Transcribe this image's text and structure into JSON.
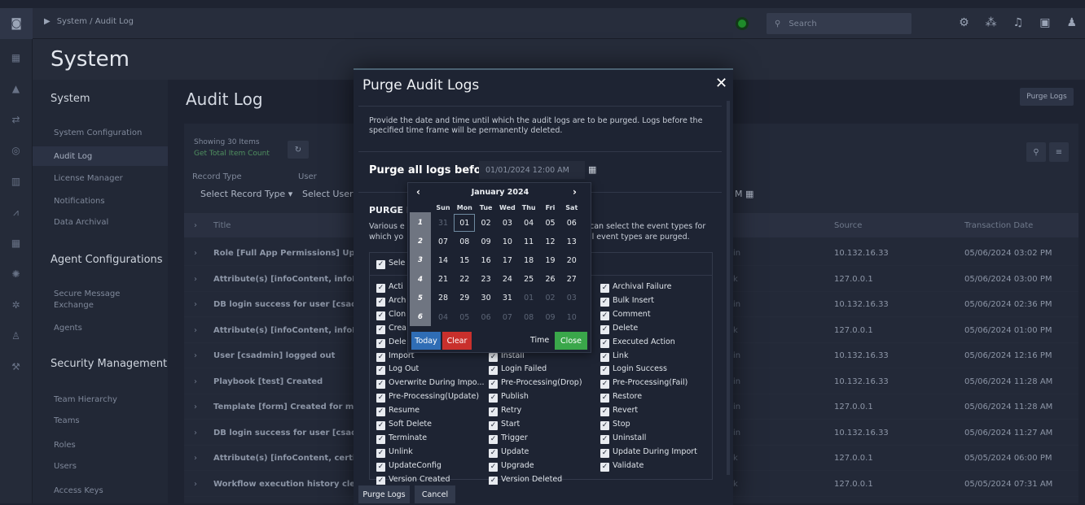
{
  "topbar": {
    "breadcrumb": "System / Audit Log",
    "search_placeholder": "Search"
  },
  "page": {
    "title": "System"
  },
  "leftnav": {
    "sections": [
      {
        "label": "System",
        "top": 0
      },
      {
        "label": "Agent Configurations"
      },
      {
        "label": "Security Management"
      }
    ],
    "items": [
      "System Configuration",
      "Audit Log",
      "License Manager",
      "Notifications",
      "Data Archival",
      "Secure Message",
      "Exchange",
      "Agents",
      "Team Hierarchy",
      "Teams",
      "Roles",
      "Users",
      "Access Keys"
    ]
  },
  "main": {
    "title": "Audit Log",
    "purge_button": "Purge Logs",
    "showing": "Showing 30 Items",
    "get_total": "Get Total Item Count",
    "record_type_label": "Record Type",
    "user_label": "User",
    "record_type_select": "Select Record Type",
    "user_select": "Select User",
    "date_filter": "M",
    "columns": {
      "title": "Title",
      "source": "Source",
      "date": "Transaction Date"
    },
    "rows": [
      {
        "title": "Role [Full App Permissions] Update",
        "op": "in",
        "source": "10.132.16.33",
        "date": "05/06/2024 03:02 PM"
      },
      {
        "title": "Attribute(s) [infoContent, infoPath",
        "op": "k",
        "source": "127.0.0.1",
        "date": "05/06/2024 03:00 PM"
      },
      {
        "title": "DB login success for user [csadmin",
        "op": "in",
        "source": "10.132.16.33",
        "date": "05/06/2024 02:36 PM"
      },
      {
        "title": "Attribute(s) [infoContent, infoPath",
        "op": "k",
        "source": "127.0.0.1",
        "date": "05/06/2024 01:00 PM"
      },
      {
        "title": "User [csadmin] logged out",
        "op": "in",
        "source": "10.132.16.33",
        "date": "05/06/2024 12:16 PM"
      },
      {
        "title": "Playbook [test] Created",
        "op": "in",
        "source": "10.132.16.33",
        "date": "05/06/2024 11:28 AM"
      },
      {
        "title": "Template [form] Created for modul",
        "op": "in",
        "source": "127.0.0.1",
        "date": "05/06/2024 11:28 AM"
      },
      {
        "title": "DB login success for user [csadmin",
        "op": "in",
        "source": "10.132.16.33",
        "date": "05/06/2024 11:27 AM"
      },
      {
        "title": "Attribute(s) [infoContent, certified",
        "op": "k",
        "source": "127.0.0.1",
        "date": "05/05/2024 06:00 PM"
      },
      {
        "title": "Workflow execution history cleanu",
        "op": "k",
        "source": "127.0.0.1",
        "date": "05/05/2024 07:31 AM"
      }
    ]
  },
  "modal": {
    "title": "Purge Audit Logs",
    "description": "Provide the date and time until which the audit logs are to be purged. Logs before the specified time frame will be permanently deleted.",
    "purge_before_label": "Purge all logs before,",
    "date_value": "01/01/2024 12:00 AM",
    "purge_section_label": "PURGE L",
    "various_left": "Various e",
    "various_left2": "which yo",
    "various_right": "can select the event types for",
    "various_right2": "ll event types are purged.",
    "select_all": "Sele",
    "events_col1": [
      "Acti",
      "Arch",
      "Clon",
      "Crea",
      "Dele",
      "Import",
      "Log Out",
      "Overwrite During Impo...",
      "Pre-Processing(Update)",
      "Resume",
      "Soft Delete",
      "Terminate",
      "Unlink",
      "UpdateConfig",
      "Version Created"
    ],
    "events_col2": [
      "",
      "",
      "",
      "",
      "",
      "Install",
      "Login Failed",
      "Pre-Processing(Drop)",
      "Publish",
      "Retry",
      "Start",
      "Trigger",
      "Update",
      "Upgrade",
      "Version Deleted"
    ],
    "events_col3": [
      "Archival Failure",
      "Bulk Insert",
      "Comment",
      "Delete",
      "Executed Action",
      "Link",
      "Login Success",
      "Pre-Processing(Fail)",
      "Restore",
      "Revert",
      "Stop",
      "Uninstall",
      "Update During Import",
      "Validate",
      ""
    ],
    "purge_button": "Purge Logs",
    "cancel_button": "Cancel"
  },
  "calendar": {
    "month_label": "January 2024",
    "dow": [
      "Sun",
      "Mon",
      "Tue",
      "Wed",
      "Thu",
      "Fri",
      "Sat"
    ],
    "weeks": [
      {
        "wk": "1",
        "days": [
          "31",
          "01",
          "02",
          "03",
          "04",
          "05",
          "06"
        ],
        "muted": [
          true,
          false,
          false,
          false,
          false,
          false,
          false
        ]
      },
      {
        "wk": "2",
        "days": [
          "07",
          "08",
          "09",
          "10",
          "11",
          "12",
          "13"
        ],
        "muted": [
          false,
          false,
          false,
          false,
          false,
          false,
          false
        ]
      },
      {
        "wk": "3",
        "days": [
          "14",
          "15",
          "16",
          "17",
          "18",
          "19",
          "20"
        ],
        "muted": [
          false,
          false,
          false,
          false,
          false,
          false,
          false
        ]
      },
      {
        "wk": "4",
        "days": [
          "21",
          "22",
          "23",
          "24",
          "25",
          "26",
          "27"
        ],
        "muted": [
          false,
          false,
          false,
          false,
          false,
          false,
          false
        ]
      },
      {
        "wk": "5",
        "days": [
          "28",
          "29",
          "30",
          "31",
          "01",
          "02",
          "03"
        ],
        "muted": [
          false,
          false,
          false,
          false,
          true,
          true,
          true
        ]
      },
      {
        "wk": "6",
        "days": [
          "04",
          "05",
          "06",
          "07",
          "08",
          "09",
          "10"
        ],
        "muted": [
          true,
          true,
          true,
          true,
          true,
          true,
          true
        ]
      }
    ],
    "selected": "01",
    "today_button": "Today",
    "clear_button": "Clear",
    "time_label": "Time",
    "close_button": "Close"
  }
}
